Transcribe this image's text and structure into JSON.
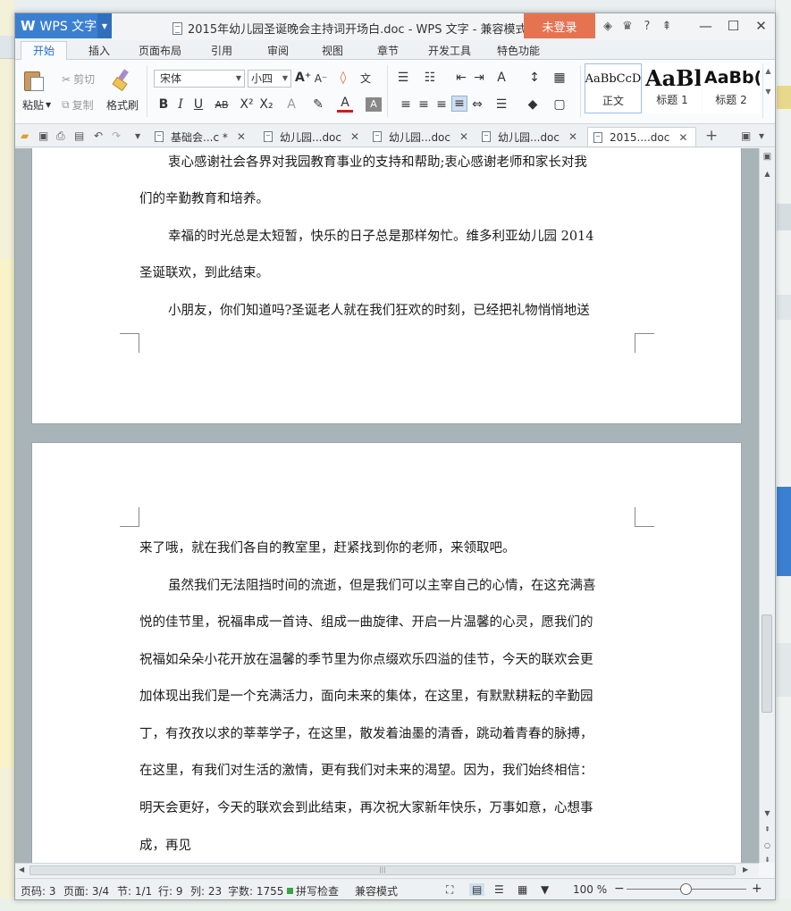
{
  "window": {
    "app_name": "WPS 文字",
    "title": "2015年幼儿园圣诞晚会主持词开场白.doc - WPS 文字 - 兼容模式",
    "login_label": "未登录"
  },
  "ribbon_tabs": [
    "开始",
    "插入",
    "页面布局",
    "引用",
    "审阅",
    "视图",
    "章节",
    "开发工具",
    "特色功能"
  ],
  "clipboard": {
    "paste": "粘贴",
    "cut": "剪切",
    "copy": "复制",
    "format_painter": "格式刷"
  },
  "font": {
    "family": "宋体",
    "size": "小四"
  },
  "styles": [
    {
      "sample": "AaBbCcD",
      "label": "正文"
    },
    {
      "sample": "AaBl",
      "label": "标题 1"
    },
    {
      "sample": "AaBb(",
      "label": "标题 2"
    }
  ],
  "doc_tabs": [
    {
      "label": "基础会...c *"
    },
    {
      "label": "幼儿园...doc"
    },
    {
      "label": "幼儿园...doc"
    },
    {
      "label": "幼儿园...doc"
    },
    {
      "label": "2015....doc"
    }
  ],
  "page1_paragraphs": [
    "衷心感谢社会各界对我园教育事业的支持和帮助;衷心感谢老师和家长对我",
    "们的辛勤教育和培养。",
    "幸福的时光总是太短暂，快乐的日子总是那样匆忙。维多利亚幼儿园 2014",
    "圣诞联欢，到此结束。",
    "小朋友，你们知道吗?圣诞老人就在我们狂欢的时刻，已经把礼物悄悄地送"
  ],
  "page2_paragraphs": [
    "来了哦，就在我们各自的教室里，赶紧找到你的老师，来领取吧。",
    "虽然我们无法阻挡时间的流逝，但是我们可以主宰自己的心情，在这充满喜",
    "悦的佳节里，祝福串成一首诗、组成一曲旋律、开启一片温馨的心灵，愿我们的",
    "祝福如朵朵小花开放在温馨的季节里为你点缀欢乐四溢的佳节，今天的联欢会更",
    "加体现出我们是一个充满活力，面向未来的集体，在这里，有默默耕耘的辛勤园",
    "丁，有孜孜以求的莘莘学子，在这里，散发着油墨的清香，跳动着青春的脉搏，",
    "在这里，有我们对生活的激情，更有我们对未来的渴望。因为，我们始终相信：",
    "明天会更好，今天的联欢会到此结束，再次祝大家新年快乐，万事如意，心想事",
    "成，再见"
  ],
  "status": {
    "page_code": "页码: 3",
    "page": "页面: 3/4",
    "section": "节: 1/1",
    "row": "行: 9",
    "col": "列: 23",
    "word_count": "字数: 1755",
    "spell_check": "拼写检查",
    "compat_mode": "兼容模式",
    "zoom": "100 %"
  },
  "accent_colors": {
    "app_blue": "#3b7fd1",
    "login_orange": "#e57352",
    "active_tab_text": "#2a6bbf"
  }
}
